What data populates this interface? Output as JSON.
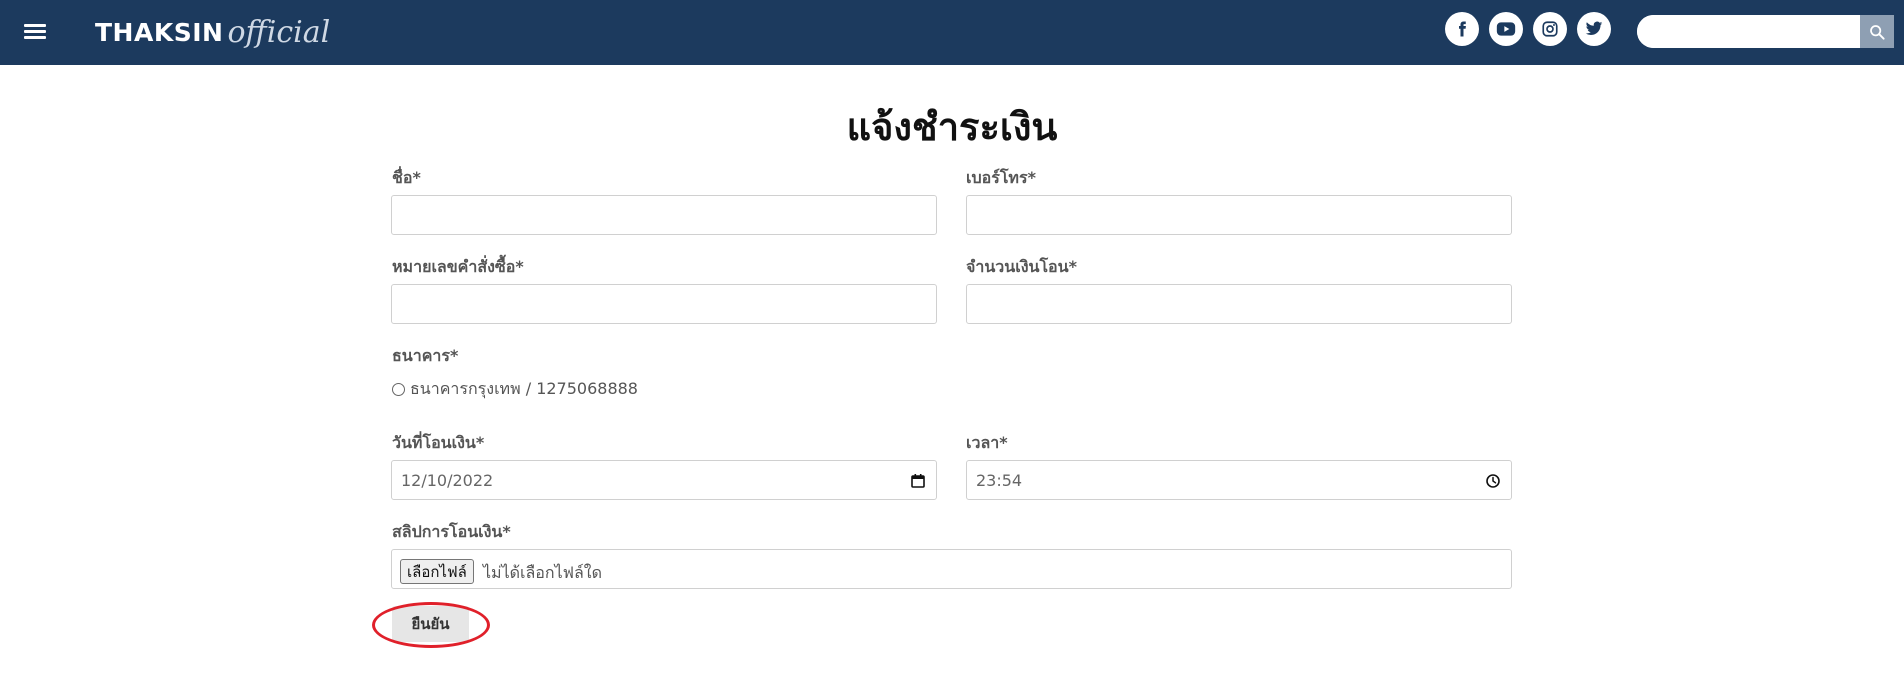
{
  "header": {
    "logo_main": "THAKSIN",
    "logo_script": "official",
    "search_placeholder": ""
  },
  "icons": {
    "menu": "menu-icon",
    "facebook": "facebook-icon",
    "youtube": "youtube-icon",
    "instagram": "instagram-icon",
    "twitter": "twitter-icon",
    "search": "search-icon",
    "calendar": "calendar-icon",
    "clock": "clock-icon"
  },
  "colors": {
    "header_bg": "#1c3a5e",
    "highlight": "#e0202a"
  },
  "form": {
    "title": "แจ้งชำระเงิน",
    "name_label": "ชื่อ*",
    "name_value": "",
    "phone_label": "เบอร์โทร*",
    "phone_value": "",
    "order_label": "หมายเลขคำสั่งซื้อ*",
    "order_value": "",
    "amount_label": "จำนวนเงินโอน*",
    "amount_value": "",
    "bank_label": "ธนาคาร*",
    "bank_option": "ธนาคารกรุงเทพ  /  1275068888",
    "date_label": "วันที่โอนเงิน*",
    "date_value": "12/10/2022",
    "time_label": "เวลา*",
    "time_value": "23:54",
    "slip_label": "สลิปการโอนเงิน*",
    "file_button": "เลือกไฟล์",
    "file_status": "ไม่ได้เลือกไฟล์ใด",
    "submit": "ยืนยัน"
  }
}
